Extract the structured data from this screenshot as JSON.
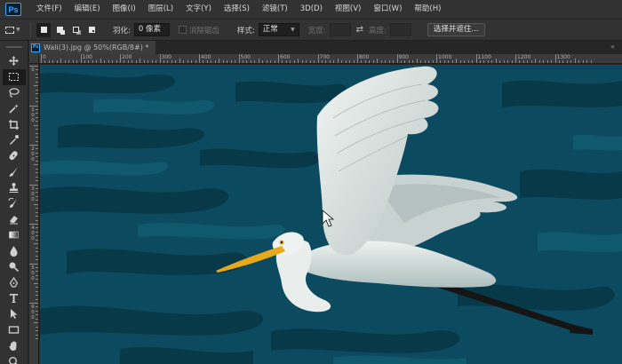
{
  "app": {
    "logo": "Ps"
  },
  "menu": [
    "文件(F)",
    "编辑(E)",
    "图像(I)",
    "图层(L)",
    "文字(Y)",
    "选择(S)",
    "滤镜(T)",
    "3D(D)",
    "视图(V)",
    "窗口(W)",
    "帮助(H)"
  ],
  "options": {
    "feather_label": "羽化:",
    "feather_value": "0 像素",
    "antialias_label": "消除锯齿",
    "style_label": "样式:",
    "style_value": "正常",
    "width_label": "宽度:",
    "height_label": "高度:",
    "select_mask_button": "选择并遮住..."
  },
  "document": {
    "tab_title": "Wali(3).jpg @ 50%(RGB/8#) *"
  },
  "rulers": {
    "horizontal": [
      "0",
      "100",
      "200",
      "300",
      "400",
      "500",
      "600",
      "700",
      "800",
      "900",
      "1000",
      "1100",
      "1200",
      "1300"
    ],
    "vertical": [
      "0",
      "100",
      "200",
      "300",
      "400",
      "500",
      "600"
    ]
  },
  "tools": [
    {
      "name": "move-tool-icon"
    },
    {
      "name": "marquee-tool-icon",
      "active": true
    },
    {
      "name": "lasso-tool-icon"
    },
    {
      "name": "magic-wand-tool-icon"
    },
    {
      "name": "crop-tool-icon"
    },
    {
      "name": "eyedropper-tool-icon"
    },
    {
      "name": "healing-brush-tool-icon"
    },
    {
      "name": "brush-tool-icon"
    },
    {
      "name": "clone-stamp-tool-icon"
    },
    {
      "name": "history-brush-tool-icon"
    },
    {
      "name": "eraser-tool-icon"
    },
    {
      "name": "gradient-tool-icon"
    },
    {
      "name": "blur-tool-icon"
    },
    {
      "name": "dodge-tool-icon"
    },
    {
      "name": "pen-tool-icon"
    },
    {
      "name": "type-tool-icon"
    },
    {
      "name": "path-selection-tool-icon"
    },
    {
      "name": "rectangle-tool-icon"
    },
    {
      "name": "hand-tool-icon"
    },
    {
      "name": "zoom-tool-icon"
    }
  ],
  "colors": {
    "canvas_bg": "#0b4a5e",
    "accent": "#31a8ff",
    "bill": "#e8a81c"
  }
}
